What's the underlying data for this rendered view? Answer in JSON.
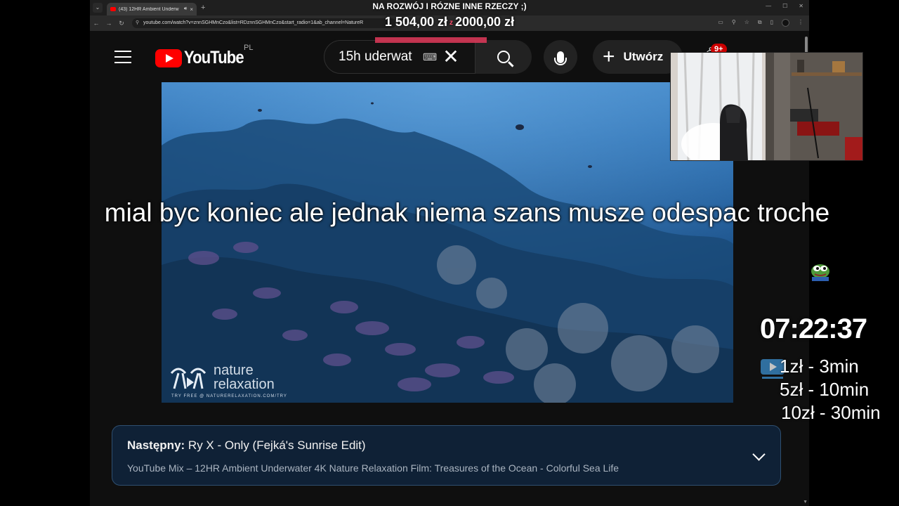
{
  "browser": {
    "tab_title": "(43) 12HR Ambient Underw",
    "address": "youtube.com/watch?v=znnSGHMnCzo&list=RDznnSGHMnCzo&start_radio=1&ab_channel=NatureR",
    "win_min": "—",
    "win_max": "☐",
    "win_close": "✕"
  },
  "stream": {
    "goal_title": "NA ROZWÓJ I RÓZNE INNE RZECZY ;)",
    "goal_current": "1 504,00 zł",
    "goal_sep": "z",
    "goal_target": "2000,00 zł",
    "goal_progress": 0.752,
    "message": "mial byc koniec ale jednak niema szans musze odespac troche",
    "timer": "07:22:37",
    "rates": [
      "1zł - 3min",
      "5zł - 10min",
      "10zł - 30min"
    ]
  },
  "youtube": {
    "logo_text": "YouTube",
    "country_code": "PL",
    "search_query": "15h uderwat",
    "keyboard_icon": "⌨",
    "clear_icon": "✕",
    "create_label": "Utwórz",
    "notifications_count": "9+",
    "watermark_line1": "nature",
    "watermark_line2": "relaxation",
    "watermark_url": "TRY FREE @ NATURERELAXATION.COM/TRY",
    "up_next_label": "Następny:",
    "up_next_title": "Ry X - Only (Fejká's Sunrise Edit)",
    "mix_title": "YouTube Mix – 12HR Ambient Underwater 4K Nature Relaxation Film: Treasures of the Ocean - Colorful Sea Life"
  },
  "colors": {
    "yt_red": "#ff0000",
    "goal_bar": "#e23a5a",
    "upnext_bg": "#0f2136"
  }
}
